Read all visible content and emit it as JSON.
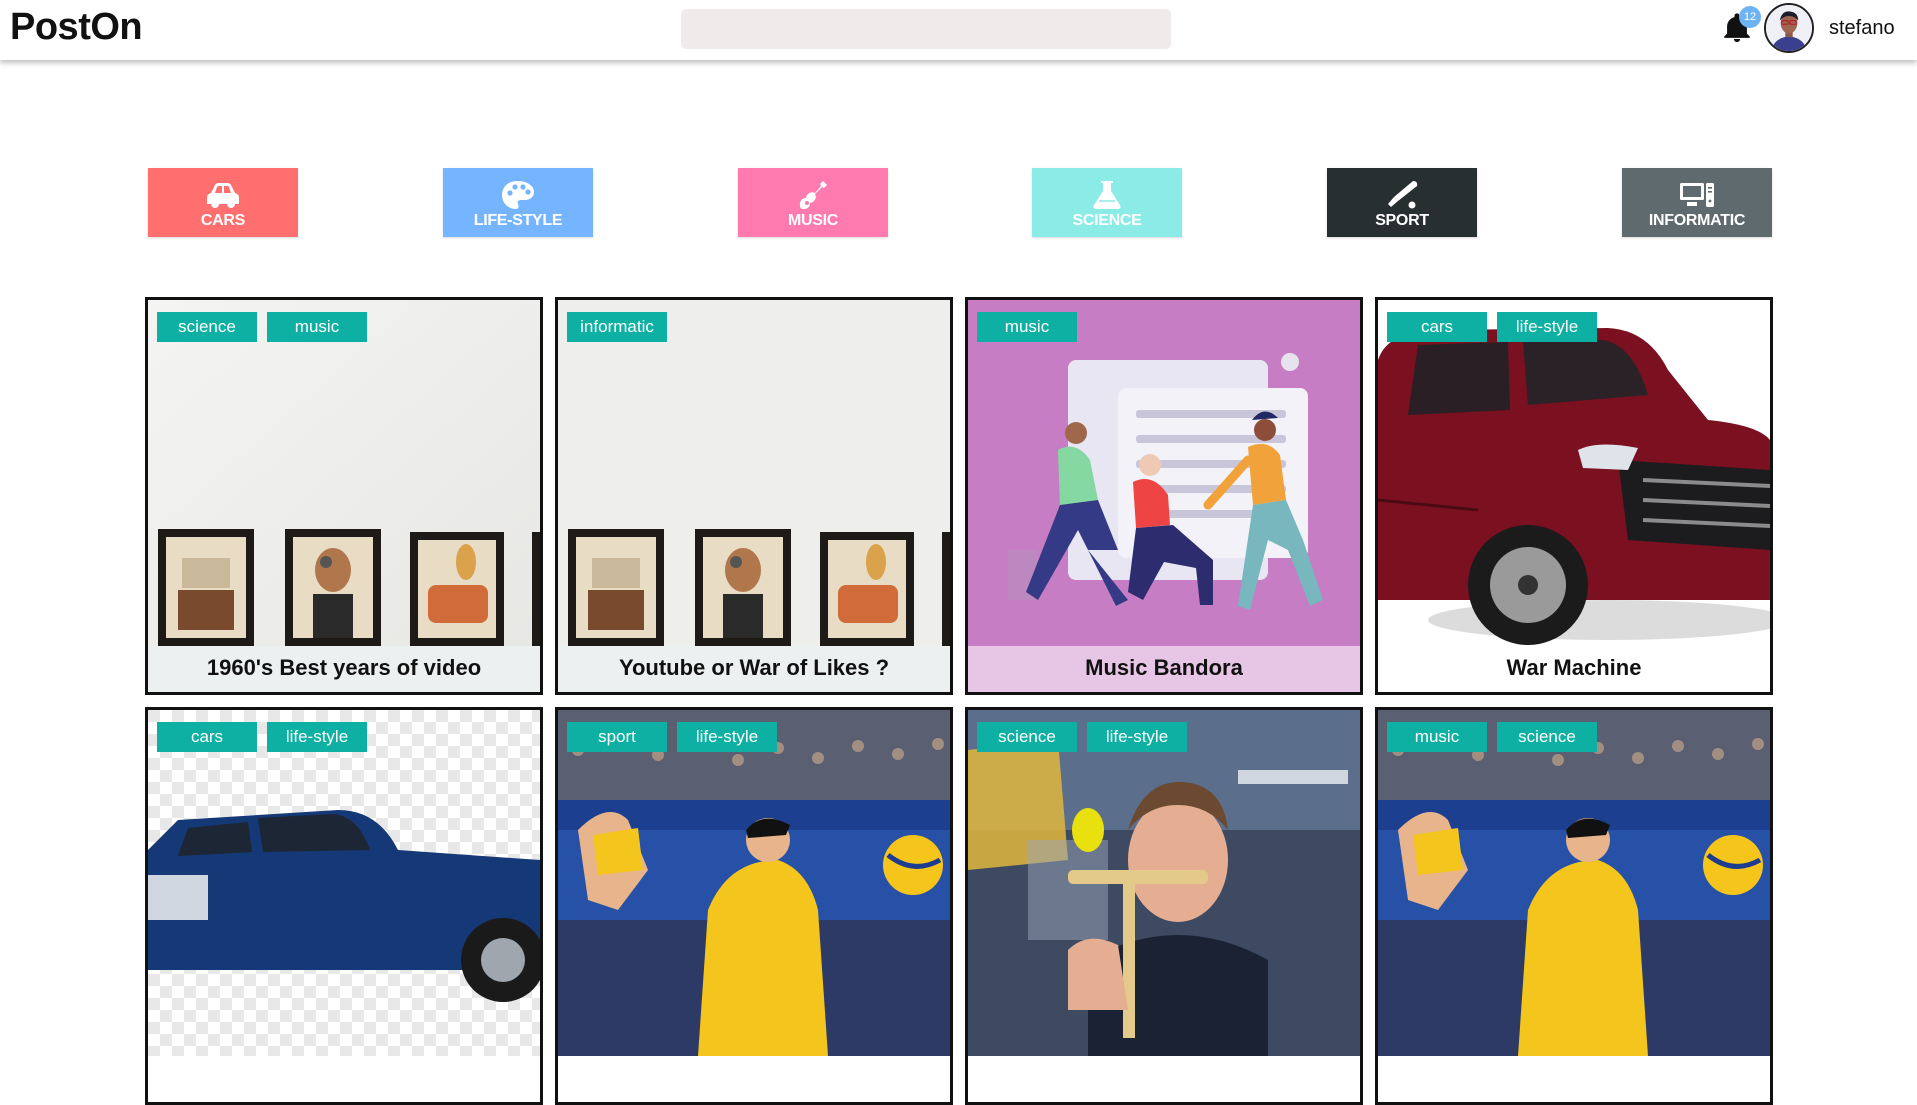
{
  "header": {
    "logo": "PostOn",
    "search_placeholder": "",
    "notification_count": "12",
    "username": "stefano"
  },
  "categories": [
    {
      "label": "CARS",
      "icon": "car-icon",
      "color": "#ff6f6f"
    },
    {
      "label": "LIFE-STYLE",
      "icon": "palette-icon",
      "color": "#75b5ff"
    },
    {
      "label": "MUSIC",
      "icon": "guitar-icon",
      "color": "#ff7aae"
    },
    {
      "label": "SCIENCE",
      "icon": "flask-icon",
      "color": "#8aebe7"
    },
    {
      "label": "SPORT",
      "icon": "baseball-bat-icon",
      "color": "#282f31"
    },
    {
      "label": "INFORMATIC",
      "icon": "computer-icon",
      "color": "#5f6a6f"
    }
  ],
  "colors": {
    "tag_background": "#0db0a2",
    "card_border": "#111111"
  },
  "posts": [
    {
      "title": "1960's Best years of video",
      "tags": [
        "science",
        "music"
      ],
      "image": "framed-pictures-on-wall",
      "caption_bg": "#edf0f1"
    },
    {
      "title": "Youtube or War of Likes ?",
      "tags": [
        "informatic"
      ],
      "image": "framed-pictures-on-wall",
      "caption_bg": "#edf0f1"
    },
    {
      "title": "Music Bandora",
      "tags": [
        "music"
      ],
      "image": "people-dashboard-illustration",
      "caption_bg": "#e7c5e5"
    },
    {
      "title": "War Machine",
      "tags": [
        "cars",
        "life-style"
      ],
      "image": "red-pickup-truck",
      "caption_bg": "#ffffff"
    },
    {
      "title": "",
      "tags": [
        "cars",
        "life-style"
      ],
      "image": "blue-pickup-truck",
      "caption_bg": "#ffffff"
    },
    {
      "title": "",
      "tags": [
        "sport",
        "life-style"
      ],
      "image": "beach-volleyball",
      "caption_bg": "#ffffff"
    },
    {
      "title": "",
      "tags": [
        "science",
        "life-style"
      ],
      "image": "man-with-toy",
      "caption_bg": "#ffffff"
    },
    {
      "title": "",
      "tags": [
        "music",
        "science"
      ],
      "image": "beach-volleyball",
      "caption_bg": "#ffffff"
    }
  ]
}
